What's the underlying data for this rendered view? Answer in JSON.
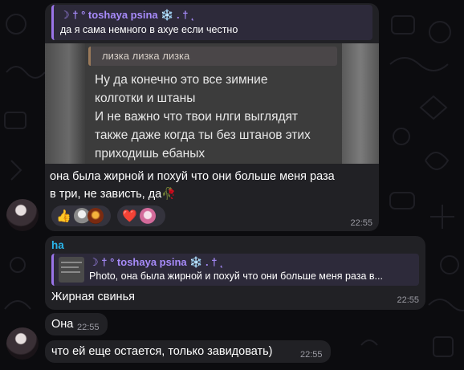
{
  "colors": {
    "background": "#0c0c0f",
    "bubble": "#212125",
    "reply_bg": "#2d2a3a",
    "reply_accent": "#9a74e8",
    "reply_name": "#a78bfa",
    "sender_name": "#2ab4e8",
    "timestamp": "#9b9ba3"
  },
  "messages": [
    {
      "reply": {
        "author": "☽ † ° toshaya psina ❄️ . † ˛",
        "text": "да я сама немного в ахуе если честно"
      },
      "photo": {
        "inner_quote": "лизка лизка лизка",
        "lines": [
          "Ну да конечно это все зимние",
          "колготки и штаны",
          "И не важно что твои нлги выглядят",
          "также даже когда ты без штанов этих",
          "приходишь ебаных"
        ]
      },
      "caption": [
        "она была жирной и похуй что они больше меня раза",
        "в три, не зависть, да🥀"
      ],
      "reactions": [
        {
          "emoji": "👍",
          "icon": "thumbs-up",
          "avatars": [
            "reactor-1",
            "reactor-2"
          ]
        },
        {
          "emoji": "❤️",
          "icon": "heart",
          "avatars": [
            "reactor-3"
          ]
        }
      ],
      "time": "22:55"
    },
    {
      "sender": "ha",
      "reply": {
        "author": "☽ † ° toshaya psina ❄️ . † ˛",
        "text": "Photo, она была жирной и похуй что они больше меня раза в..."
      },
      "text": "Жирная свинья",
      "time": "22:55"
    },
    {
      "text": "Она",
      "time": "22:55"
    },
    {
      "text": "что ей еще остается, только завидовать)",
      "time": "22:55"
    }
  ]
}
